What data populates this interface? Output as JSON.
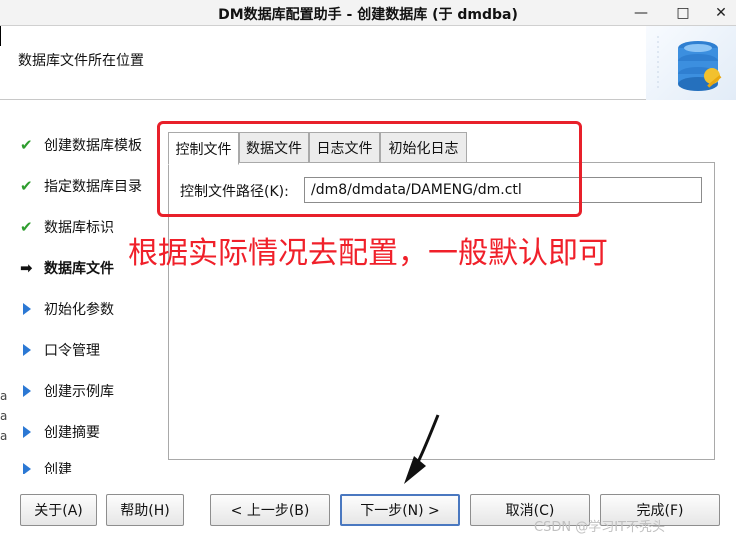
{
  "window": {
    "title": "DM数据库配置助手 - 创建数据库 (于 dmdba)",
    "minimize": "—",
    "maximize": "□",
    "close": "✕"
  },
  "header": {
    "title": "数据库文件所在位置",
    "icon": "database-settings-icon"
  },
  "nav": {
    "items": [
      {
        "label": "创建数据库模板",
        "state": "done"
      },
      {
        "label": "指定数据库目录",
        "state": "done"
      },
      {
        "label": "数据库标识",
        "state": "done"
      },
      {
        "label": "数据库文件",
        "state": "current"
      },
      {
        "label": "初始化参数",
        "state": "pending"
      },
      {
        "label": "口令管理",
        "state": "pending"
      },
      {
        "label": "创建示例库",
        "state": "pending"
      },
      {
        "label": "创建摘要",
        "state": "pending"
      },
      {
        "label": "创建",
        "state": "pending"
      }
    ]
  },
  "side_edge": [
    "a",
    "a",
    "a"
  ],
  "tabs": [
    {
      "label": "控制文件",
      "active": true
    },
    {
      "label": "数据文件",
      "active": false
    },
    {
      "label": "日志文件",
      "active": false
    },
    {
      "label": "初始化日志",
      "active": false
    }
  ],
  "control_file": {
    "label": "控制文件路径(K):",
    "value": "/dm8/dmdata/DAMENG/dm.ctl"
  },
  "annotation": {
    "text": "根据实际情况去配置，一般默认即可",
    "color": "#f0202a"
  },
  "buttons": {
    "about": "关于(A)",
    "help": "帮助(H)",
    "prev": "< 上一步(B)",
    "next": "下一步(N) >",
    "cancel": "取消(C)",
    "finish": "完成(F)"
  },
  "watermark": "CSDN @学习IT不秃头",
  "colors": {
    "check": "#2e9d2e",
    "pending_arrow": "#2b78d4",
    "annotation_red": "#e8202a"
  }
}
